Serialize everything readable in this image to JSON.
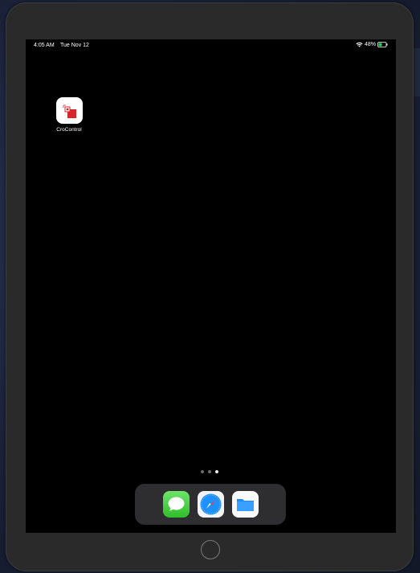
{
  "status_bar": {
    "time": "4:05 AM",
    "date": "Tue Nov 12",
    "battery_percent": "48%",
    "battery_level": 0.48,
    "wifi_icon": "wifi-icon",
    "battery_icon": "battery-icon"
  },
  "home_screen": {
    "apps": [
      {
        "label": "CroControl",
        "icon": "crocontrol-app-icon"
      }
    ],
    "page_dots": {
      "count": 3,
      "active_index": 2
    }
  },
  "dock": {
    "apps": [
      {
        "name": "Messages",
        "icon": "messages-icon",
        "color": "#34c759"
      },
      {
        "name": "Safari",
        "icon": "safari-icon",
        "color": "#1e90ff"
      },
      {
        "name": "Files",
        "icon": "files-icon",
        "color": "#1a8cff"
      }
    ]
  },
  "device": {
    "home_button_icon": "home-button"
  }
}
